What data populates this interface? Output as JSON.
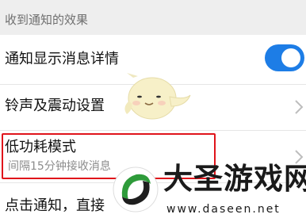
{
  "section_header": "收到通知的效果",
  "rows": [
    {
      "title": "通知显示消息详情",
      "toggle_on": true
    },
    {
      "title": "铃声及震动设置"
    },
    {
      "title": "低功耗模式",
      "subtitle": "间隔15分钟接收消息"
    },
    {
      "title": "点击通知，直接"
    }
  ],
  "watermark": {
    "name": "大圣游戏网",
    "url": "www.daseen.net"
  },
  "colors": {
    "accent": "#1d7de6",
    "highlight": "#e0141b",
    "watermark_green": "#2e9b3a"
  }
}
